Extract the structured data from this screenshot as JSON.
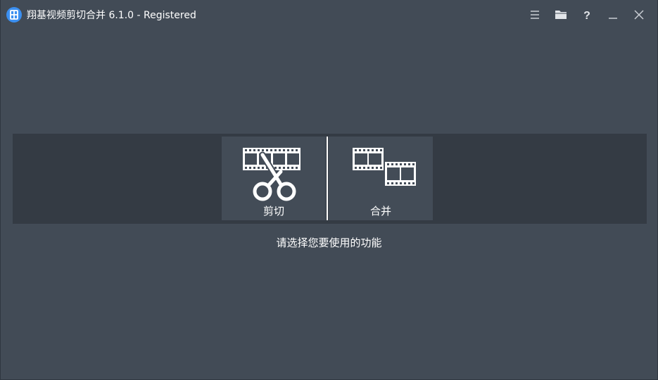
{
  "window": {
    "title": "翔基视频剪切合并 6.1.0 - Registered",
    "app_icon": "film-app-icon"
  },
  "title_controls": [
    {
      "name": "menu-icon"
    },
    {
      "name": "folder-icon"
    },
    {
      "name": "help-icon",
      "glyph": "?"
    },
    {
      "name": "minimize-icon"
    },
    {
      "name": "close-icon"
    }
  ],
  "functions": {
    "cut": {
      "label": "剪切",
      "icon": "film-scissors-icon"
    },
    "merge": {
      "label": "合并",
      "icon": "film-merge-icon"
    }
  },
  "prompt": "请选择您要使用的功能",
  "colors": {
    "window_bg": "#424b56",
    "panel_bg": "#343b44",
    "button_bg": "#434c57",
    "app_icon_blue": "#3b8ff0",
    "icon_color": "#ffffff",
    "control_color": "#c9ced4"
  }
}
